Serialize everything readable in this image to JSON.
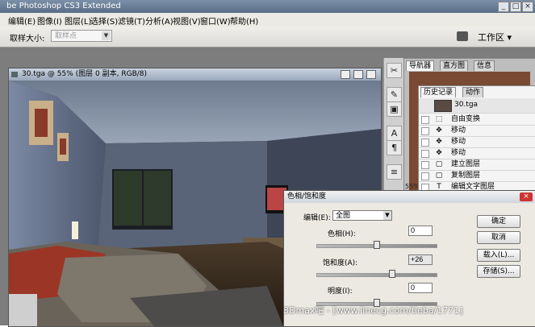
{
  "app": {
    "title": "be Photoshop CS3 Extended"
  },
  "menu": [
    "编辑(E)",
    "图像(I)",
    "图层(L)",
    "选择(S)",
    "滤镜(T)",
    "分析(A)",
    "视图(V)",
    "窗口(W)",
    "帮助(H)"
  ],
  "options": {
    "sample_label": "取样大小:",
    "sample_value": "取样点",
    "workspace_label": "工作区 ▾"
  },
  "document": {
    "tab_title": "30.tga @ 55% (图层 0 副本, RGB/8)"
  },
  "panels": {
    "top_tabs": [
      "导航器",
      "直方图",
      "信息"
    ],
    "hist_tabs": [
      "历史记录",
      "动作"
    ],
    "snapshot_label": "30.tga",
    "history": [
      "自由变换",
      "移动",
      "移动",
      "移动",
      "建立图层",
      "复制图层",
      "编辑文字图层"
    ],
    "zoom": "55%"
  },
  "dialog": {
    "title": "色相/饱和度",
    "edit_label": "编辑(E):",
    "edit_value": "全图",
    "hue_label": "色相(H):",
    "hue_value": "0",
    "sat_label": "饱和度(A):",
    "sat_value": "+26",
    "light_label": "明度(I):",
    "light_value": "0",
    "buttons": {
      "ok": "确定",
      "cancel": "取消",
      "load": "载入(L)...",
      "save": "存储(S)..."
    },
    "hue_level": 0.5,
    "sat_level": 0.63,
    "light_level": 0.5
  },
  "watermark": "3Dmax吧 - [www.linecg.com/tieba/1771]",
  "colors": {
    "accent": "#5a6d86",
    "close": "#cc3333"
  }
}
